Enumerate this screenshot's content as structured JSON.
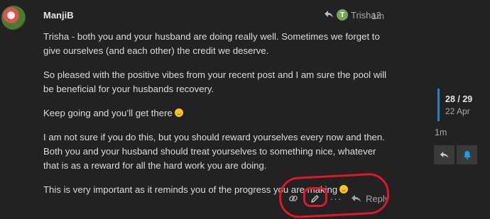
{
  "post": {
    "username": "ManjiB",
    "reply_to_initial": "T",
    "reply_to_user": "Trisha2",
    "time": "1m",
    "paragraphs": [
      "Trisha - both you and your husband are doing really well. Sometimes we forget to give ourselves (and each other) the credit we deserve.",
      "So pleased with the positive vibes from your recent post and I am sure the pool will be beneficial for your husbands recovery.",
      "Keep going and you’ll get there",
      "I am not sure if you do this, but you should reward yourselves every now and then. Both you and your husband should treat yourselves to something nice, whatever that is as a reward for all the hard work you are doing.",
      "This is very important as it reminds you of the progress you are making"
    ],
    "actions": {
      "more_label": "···",
      "reply_label": "Reply"
    }
  },
  "timeline": {
    "count": "28 / 29",
    "date": "22 Apr",
    "ago": "1m"
  },
  "colors": {
    "background": "#222222",
    "accent_blue": "#1b85c6",
    "annotation_red": "#e0162b",
    "trisha_avatar": "#7ca35b"
  }
}
